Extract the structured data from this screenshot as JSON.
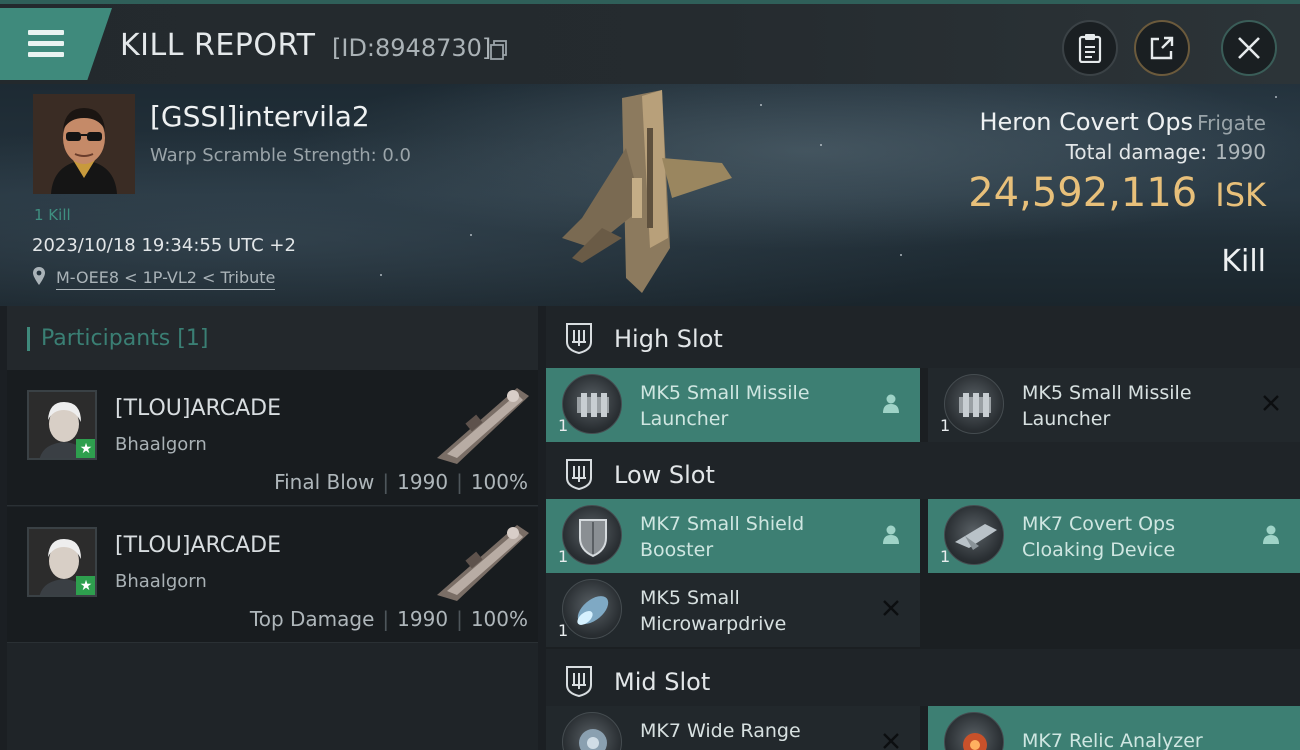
{
  "header": {
    "title": "KILL REPORT",
    "report_id": "[ID:8948730]"
  },
  "victim": {
    "name": "[GSSI]intervila2",
    "warp_scramble": "Warp Scramble Strength: 0.0",
    "kill_count": "1 Kill",
    "datetime": "2023/10/18 19:34:55 UTC +2",
    "location": "M-OEE8 < 1P-VL2 < Tribute",
    "ship_name": "Heron Covert Ops",
    "ship_class": "Frigate",
    "total_damage_label": "Total damage:",
    "total_damage": "1990",
    "isk_value": "24,592,116",
    "isk_unit": "ISK",
    "report_type": "Kill"
  },
  "participants": {
    "title": "Participants",
    "count": "[1]",
    "rows": [
      {
        "name": "[TLOU]ARCADE",
        "ship": "Bhaalgorn",
        "role": "Final Blow",
        "damage": "1990",
        "percent": "100%"
      },
      {
        "name": "[TLOU]ARCADE",
        "ship": "Bhaalgorn",
        "role": "Top Damage",
        "damage": "1990",
        "percent": "100%"
      }
    ]
  },
  "fitting": {
    "high_slot": {
      "title": "High Slot",
      "modules": [
        {
          "name": "MK5 Small Missile Launcher",
          "qty": "1",
          "state": "dropped",
          "icon": "missile-launcher-icon"
        },
        {
          "name": "MK5 Small Missile Launcher",
          "qty": "1",
          "state": "destroyed",
          "icon": "missile-launcher-icon"
        }
      ]
    },
    "low_slot": {
      "title": "Low Slot",
      "modules": [
        {
          "name": "MK7 Small Shield Booster",
          "qty": "1",
          "state": "dropped",
          "icon": "shield-booster-icon"
        },
        {
          "name": "MK7 Covert Ops Cloaking Device",
          "qty": "1",
          "state": "dropped",
          "icon": "cloaking-device-icon"
        },
        {
          "name": "MK5 Small Microwarpdrive",
          "qty": "1",
          "state": "destroyed",
          "icon": "microwarpdrive-icon"
        }
      ]
    },
    "mid_slot": {
      "title": "Mid Slot",
      "modules": [
        {
          "name": "MK7 Wide Range",
          "qty": "",
          "state": "destroyed",
          "icon": "target-painter-icon"
        },
        {
          "name": "MK7 Relic Analyzer",
          "qty": "",
          "state": "dropped",
          "icon": "relic-analyzer-icon"
        }
      ]
    }
  },
  "colors": {
    "accent_teal": "#3d7f73",
    "isk_gold": "#e8c07a",
    "background": "#1b1f22"
  }
}
